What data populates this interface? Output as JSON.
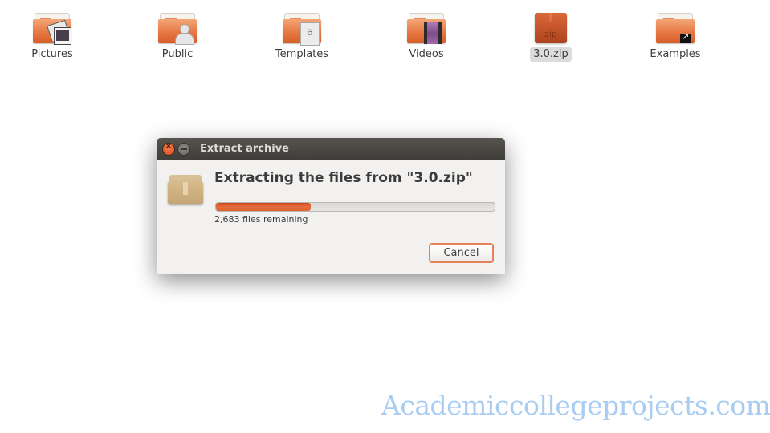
{
  "desktop": {
    "files": [
      {
        "label": "Pictures",
        "icon": "pictures-folder-icon"
      },
      {
        "label": "Public",
        "icon": "public-folder-icon"
      },
      {
        "label": "Templates",
        "icon": "templates-folder-icon"
      },
      {
        "label": "Videos",
        "icon": "videos-folder-icon"
      },
      {
        "label": "3.0.zip",
        "icon": "zip-archive-icon",
        "selected": true,
        "badge": "zip"
      },
      {
        "label": "Examples",
        "icon": "examples-folder-icon"
      }
    ]
  },
  "dialog": {
    "title": "Extract archive",
    "close_glyph": "×",
    "heading": "Extracting the files from \"3.0.zip\"",
    "progress": 0.34,
    "status": "2,683 files remaining",
    "cancel_label": "Cancel"
  },
  "colors": {
    "accent": "#dd4814",
    "progress_fill": "#e06633",
    "titlebar": "#4a4743",
    "watermark": "#a9cdf2"
  },
  "watermark": "Academiccollegeprojects.com"
}
